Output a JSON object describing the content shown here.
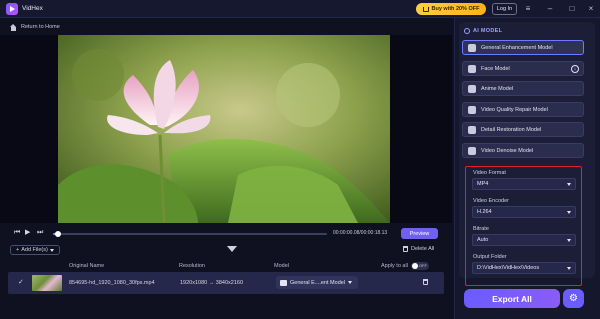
{
  "app": {
    "title": "VidHex"
  },
  "header": {
    "promo_label": "Buy with 20% OFF",
    "login_label": "Log In"
  },
  "nav": {
    "return_label": "Return to Home"
  },
  "player": {
    "timecode": "00:00:00.08/00:00:18.13",
    "preview_label": "Preview",
    "progress": 0.02
  },
  "files": {
    "add_label": "Add File(s)",
    "delete_all_label": "Delete All",
    "columns": {
      "name": "Original Name",
      "resolution": "Resolution",
      "model": "Model"
    },
    "apply_all_label": "Apply to all",
    "toggle_state": "OFF",
    "rows": [
      {
        "name": "854695-hd_1920_1080_30fps.mp4",
        "resolution": "1920x1080 → 3840x2160",
        "model": "General E....ent Model"
      }
    ]
  },
  "side": {
    "ai_label": "AI MODEL",
    "models": [
      {
        "label": "General Enhancement Model",
        "icon": "enhance-icon",
        "active": true
      },
      {
        "label": "Face Model",
        "icon": "face-icon",
        "download": true
      },
      {
        "label": "Anime Model",
        "icon": "anime-icon"
      },
      {
        "label": "Video Quality Repair Model",
        "icon": "repair-icon"
      },
      {
        "label": "Detail Restoration Model",
        "icon": "detail-icon"
      },
      {
        "label": "Video Denoise Model",
        "icon": "denoise-icon"
      }
    ],
    "settings": {
      "format_label": "Video Format",
      "format_value": "MP4",
      "encoder_label": "Video Encoder",
      "encoder_value": "H.264",
      "bitrate_label": "Bitrate",
      "bitrate_value": "Auto",
      "folder_label": "Output Folder",
      "folder_value": "D:\\VidHex\\VidHex\\Videos"
    },
    "export_label": "Export All"
  },
  "colors": {
    "accent": "#7060f2",
    "highlight_border": "#e0202a",
    "background": "#0f1020"
  }
}
